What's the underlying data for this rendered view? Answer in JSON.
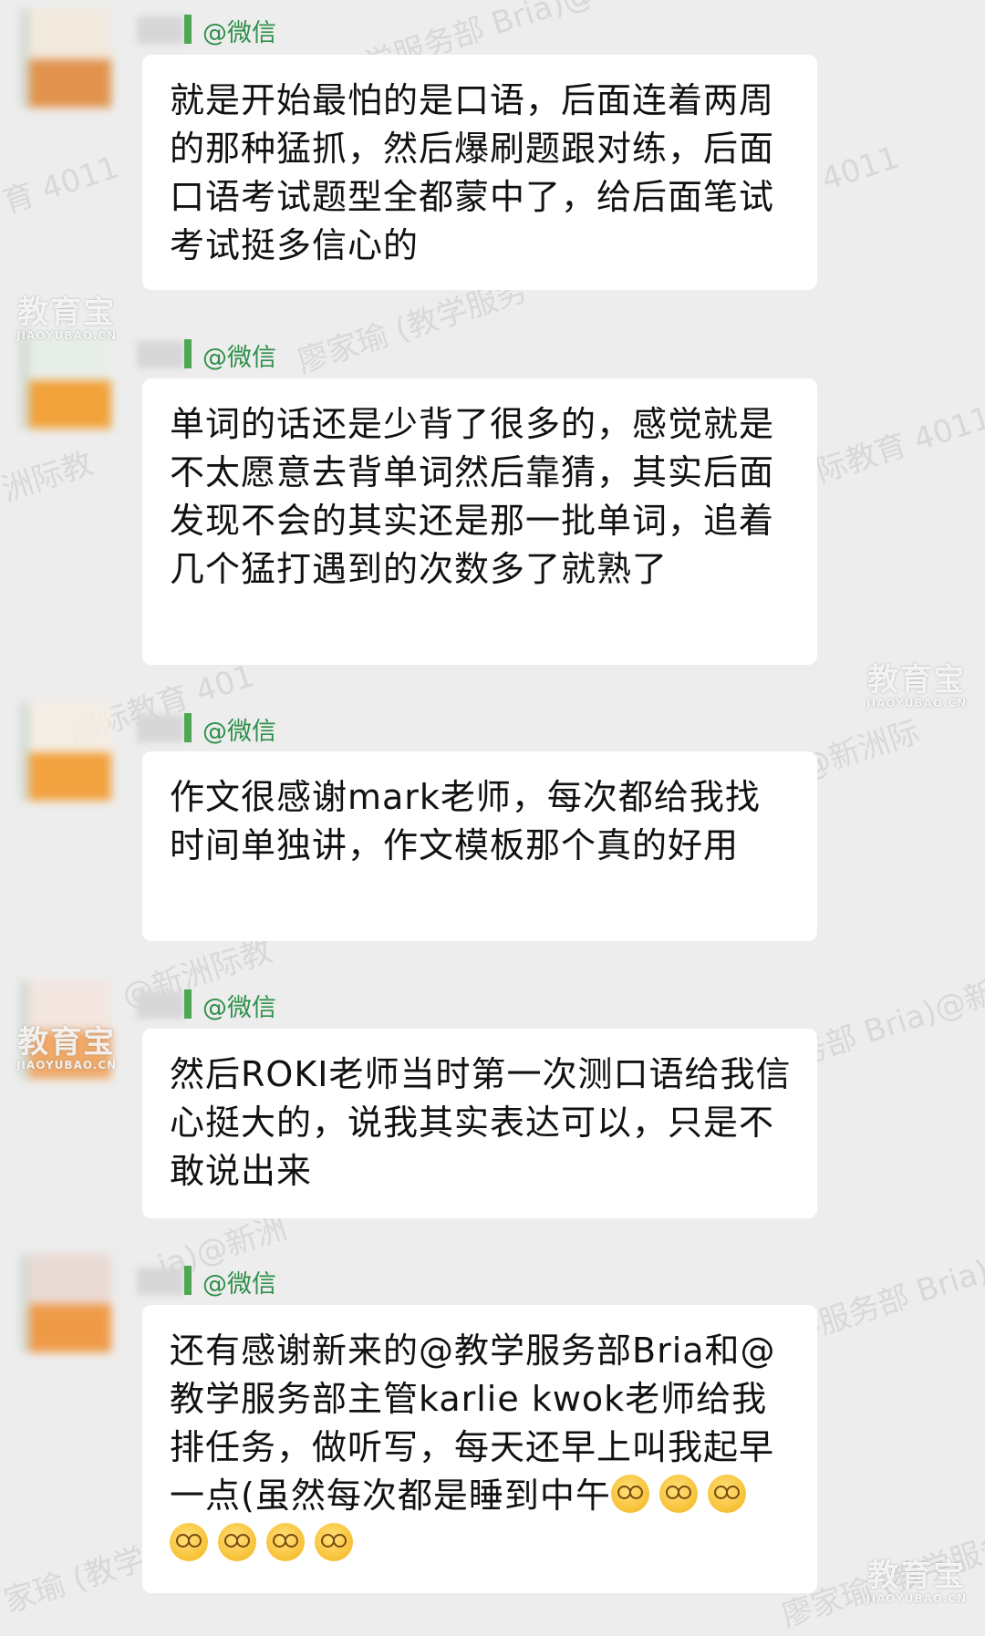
{
  "messages": [
    {
      "handle": "@微信",
      "avatar_colors": [
        "#f3e9dc",
        "#e08a3c"
      ],
      "text": "就是开始最怕的是口语，后面连着两周的那种猛抓，然后爆刷题跟对练，后面口语考试题型全都蒙中了，给后面笔试考试挺多信心的"
    },
    {
      "handle": "@微信",
      "avatar_colors": [
        "#e7efe8",
        "#f29a28"
      ],
      "text": "单词的话还是少背了很多的，感觉就是不太愿意去背单词然后靠猜，其实后面发现不会的其实还是那一批单词，追着几个猛打遇到的次数多了就熟了"
    },
    {
      "handle": "@微信",
      "avatar_colors": [
        "#f5eee4",
        "#f39a2c"
      ],
      "text": "作文很感谢mark老师，每次都给我找时间单独讲，作文模板那个真的好用"
    },
    {
      "handle": "@微信",
      "avatar_colors": [
        "#f4e6df",
        "#f0a15a"
      ],
      "text": "然后ROKI老师当时第一次测口语给我信心挺大的，说我其实表达可以，只是不敢说出来"
    },
    {
      "handle": "@微信",
      "avatar_colors": [
        "#ead8d2",
        "#f09236"
      ],
      "text": "还有感谢新来的@教学服务部Bria和@教学服务部主管karlie kwok老师给我排任务，做听写，每天还早上叫我起早一点(虽然每次都是睡到中午",
      "emoji_count": 7,
      "emoji_name": "dizzy-face-emoji"
    }
  ],
  "watermarks": {
    "logo_main": "教育宝",
    "logo_sub": "JIAOYUBAO.CN",
    "texts": [
      "教学服务部 Bria)@",
      "育 4011",
      "4011",
      "廖家瑜 (教学服务",
      "洲际教",
      "际教育 4011",
      "洲际教育 401",
      "a)@新洲际",
      "@新洲际教",
      "学服务部 Bria)@新洲",
      "ia)@新洲",
      "学服务部 Bria)",
      "家瑜 (教学服",
      "廖家瑜 (教学服务部"
    ]
  }
}
